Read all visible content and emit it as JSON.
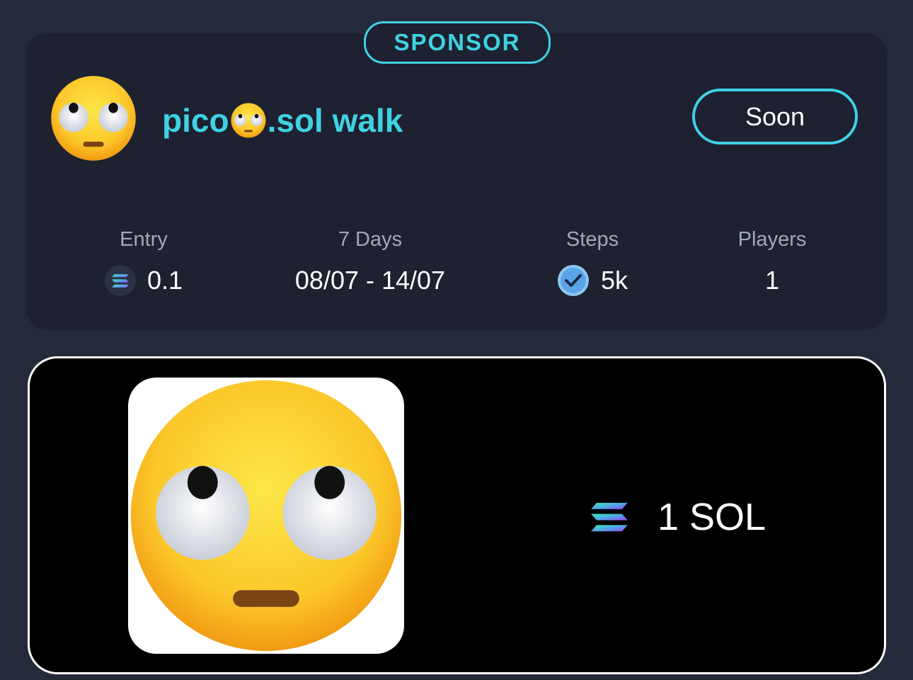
{
  "badge": {
    "label": "SPONSOR"
  },
  "challenge": {
    "title_prefix": "pico",
    "title_suffix": ".sol walk",
    "avatar_icon": "face-with-rolling-eyes-emoji",
    "action_label": "Soon"
  },
  "stats": [
    {
      "label": "Entry",
      "value": "0.1",
      "icon": "solana-icon"
    },
    {
      "label": "7 Days",
      "value": "08/07 - 14/07"
    },
    {
      "label": "Steps",
      "value": "5k",
      "icon": "check-badge-icon"
    },
    {
      "label": "Players",
      "value": "1"
    }
  ],
  "prize": {
    "image_icon": "face-with-rolling-eyes-emoji",
    "amount": "1 SOL",
    "icon": "solana-icon"
  },
  "colors": {
    "accent": "#3fd2e3",
    "background": "#252a3b",
    "card": "#1d2130",
    "prize_card": "#000000"
  }
}
